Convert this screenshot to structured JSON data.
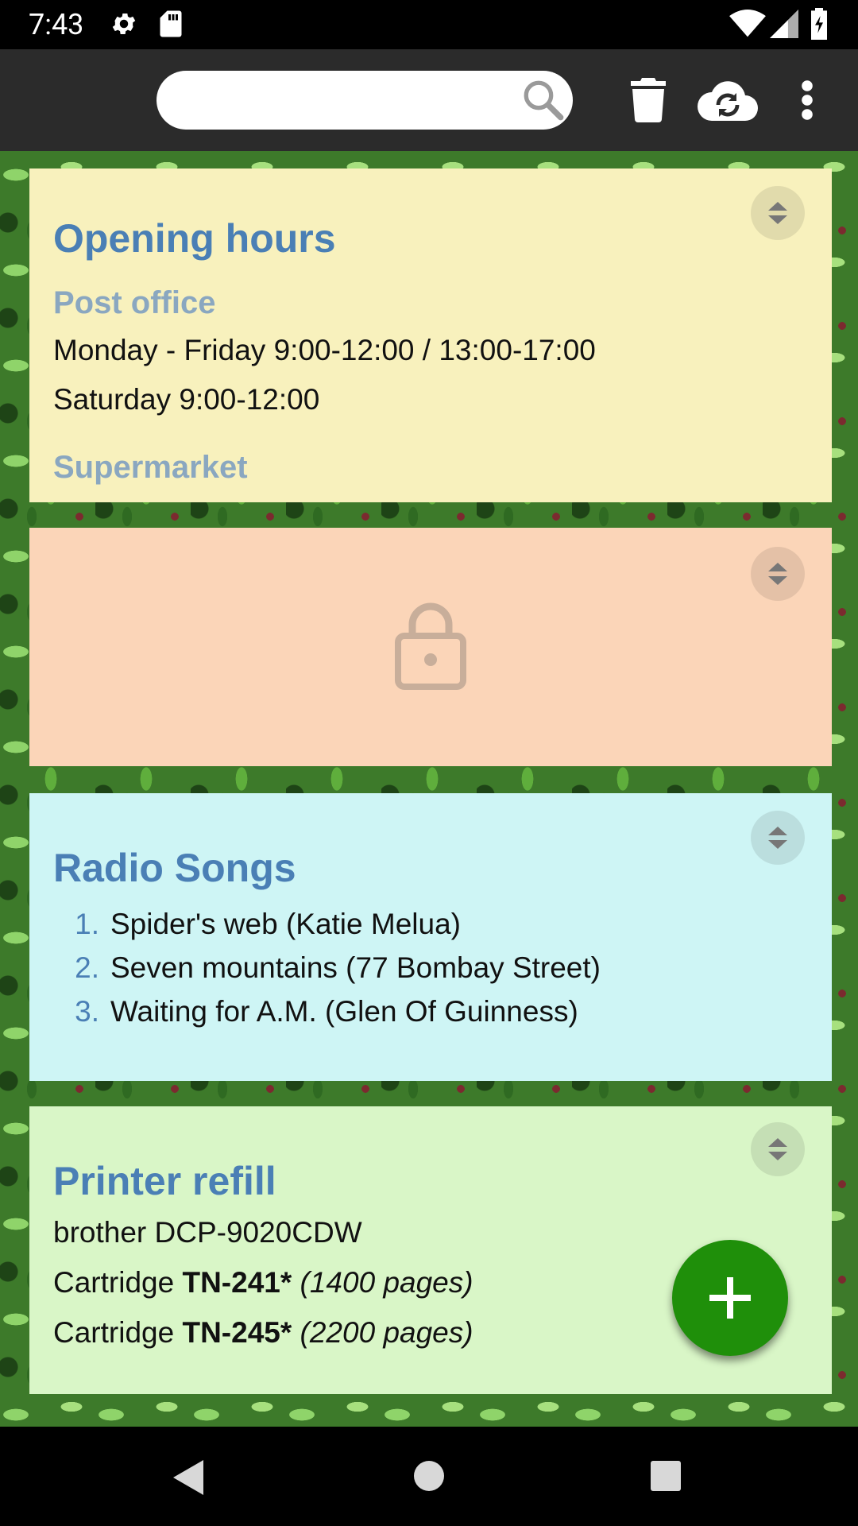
{
  "status_bar": {
    "time": "7:43",
    "icons": [
      "gear-icon",
      "sd-card-icon",
      "wifi-icon",
      "signal-icon",
      "battery-icon"
    ]
  },
  "toolbar": {
    "search": {
      "value": "",
      "placeholder": ""
    },
    "icons": [
      "search-icon",
      "trash-icon",
      "cloud-sync-icon",
      "more-vert-icon"
    ]
  },
  "notes": [
    {
      "color": "#f8f1bd",
      "title": "Opening hours",
      "subtitle1": "Post office",
      "line1": "Monday - Friday 9:00-12:00 / 13:00-17:00",
      "line2": "Saturday 9:00-12:00",
      "subtitle2": "Supermarket"
    },
    {
      "color": "#fbd5b8",
      "locked": true,
      "icon": "lock-icon"
    },
    {
      "color": "#cef5f5",
      "title": "Radio Songs",
      "items": [
        {
          "num": "1.",
          "text": "Spider's web (Katie Melua)"
        },
        {
          "num": "2.",
          "text": "Seven mountains (77 Bombay Street)"
        },
        {
          "num": "3.",
          "text": "Waiting for A.M. (Glen Of Guinness)"
        }
      ]
    },
    {
      "color": "#d9f6c7",
      "title": "Printer refill",
      "line1": "brother DCP-9020CDW",
      "cartridge_label": "Cartridge",
      "line2_code": "TN-241*",
      "line2_pages": "(1400 pages)",
      "line3_code": "TN-245*",
      "line3_pages": "(2200 pages)"
    }
  ],
  "fab": {
    "icon": "plus-icon",
    "color": "#1f8f0a"
  },
  "nav_bar": {
    "icons": [
      "back-icon",
      "home-icon",
      "recents-icon"
    ]
  }
}
